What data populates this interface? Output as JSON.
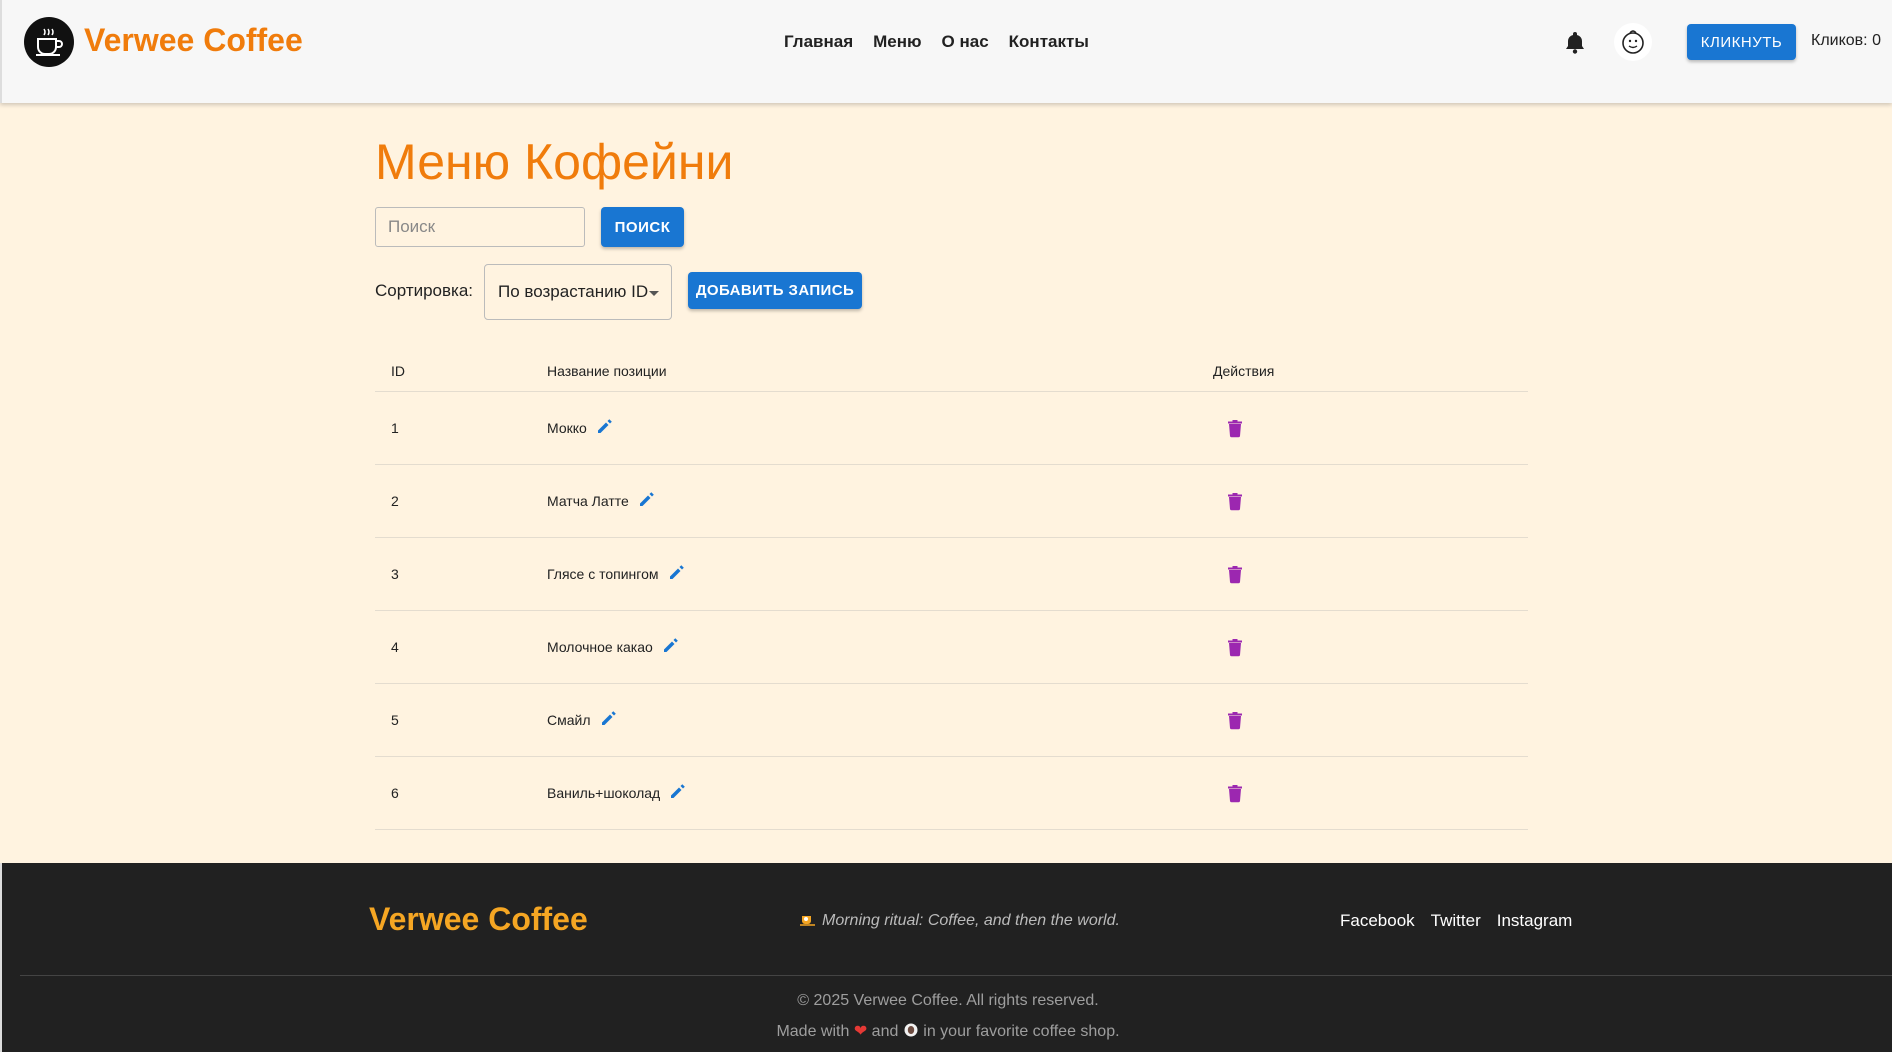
{
  "header": {
    "brand": "Verwee Coffee",
    "nav": [
      "Главная",
      "Меню",
      "О нас",
      "Контакты"
    ],
    "click_button": "Кликнуть",
    "click_count": "Кликов: 0"
  },
  "main": {
    "title": "Меню Кофейни",
    "search": {
      "placeholder": "Поиск",
      "button": "ПОИСК"
    },
    "sort": {
      "label": "Сортировка:",
      "selected": "По возрастанию ID"
    },
    "add_button": "ДОБАВИТЬ ЗАПИСЬ",
    "table": {
      "headers": {
        "id": "ID",
        "name": "Название позиции",
        "actions": "Действия"
      },
      "rows": [
        {
          "id": "1",
          "name": "Мокко"
        },
        {
          "id": "2",
          "name": "Матча Латте"
        },
        {
          "id": "3",
          "name": "Глясе с топингом"
        },
        {
          "id": "4",
          "name": "Молочное какао"
        },
        {
          "id": "5",
          "name": "Смайл"
        },
        {
          "id": "6",
          "name": "Ваниль+шоколад"
        }
      ]
    }
  },
  "footer": {
    "brand": "Verwee Coffee",
    "tagline": "Morning ritual: Coffee, and then the world.",
    "links": [
      "Facebook",
      "Twitter",
      "Instagram"
    ],
    "copyright": "© 2025 Verwee Coffee. All rights reserved.",
    "made_with_prefix": "Made with",
    "made_with_and": "and",
    "made_with_suffix": "in your favorite coffee shop."
  },
  "colors": {
    "accent_orange": "#f07c0c",
    "primary_blue": "#1976d2",
    "delete_purple": "#9c27b0",
    "footer_bg": "#212121",
    "page_bg": "#fff3e0"
  }
}
